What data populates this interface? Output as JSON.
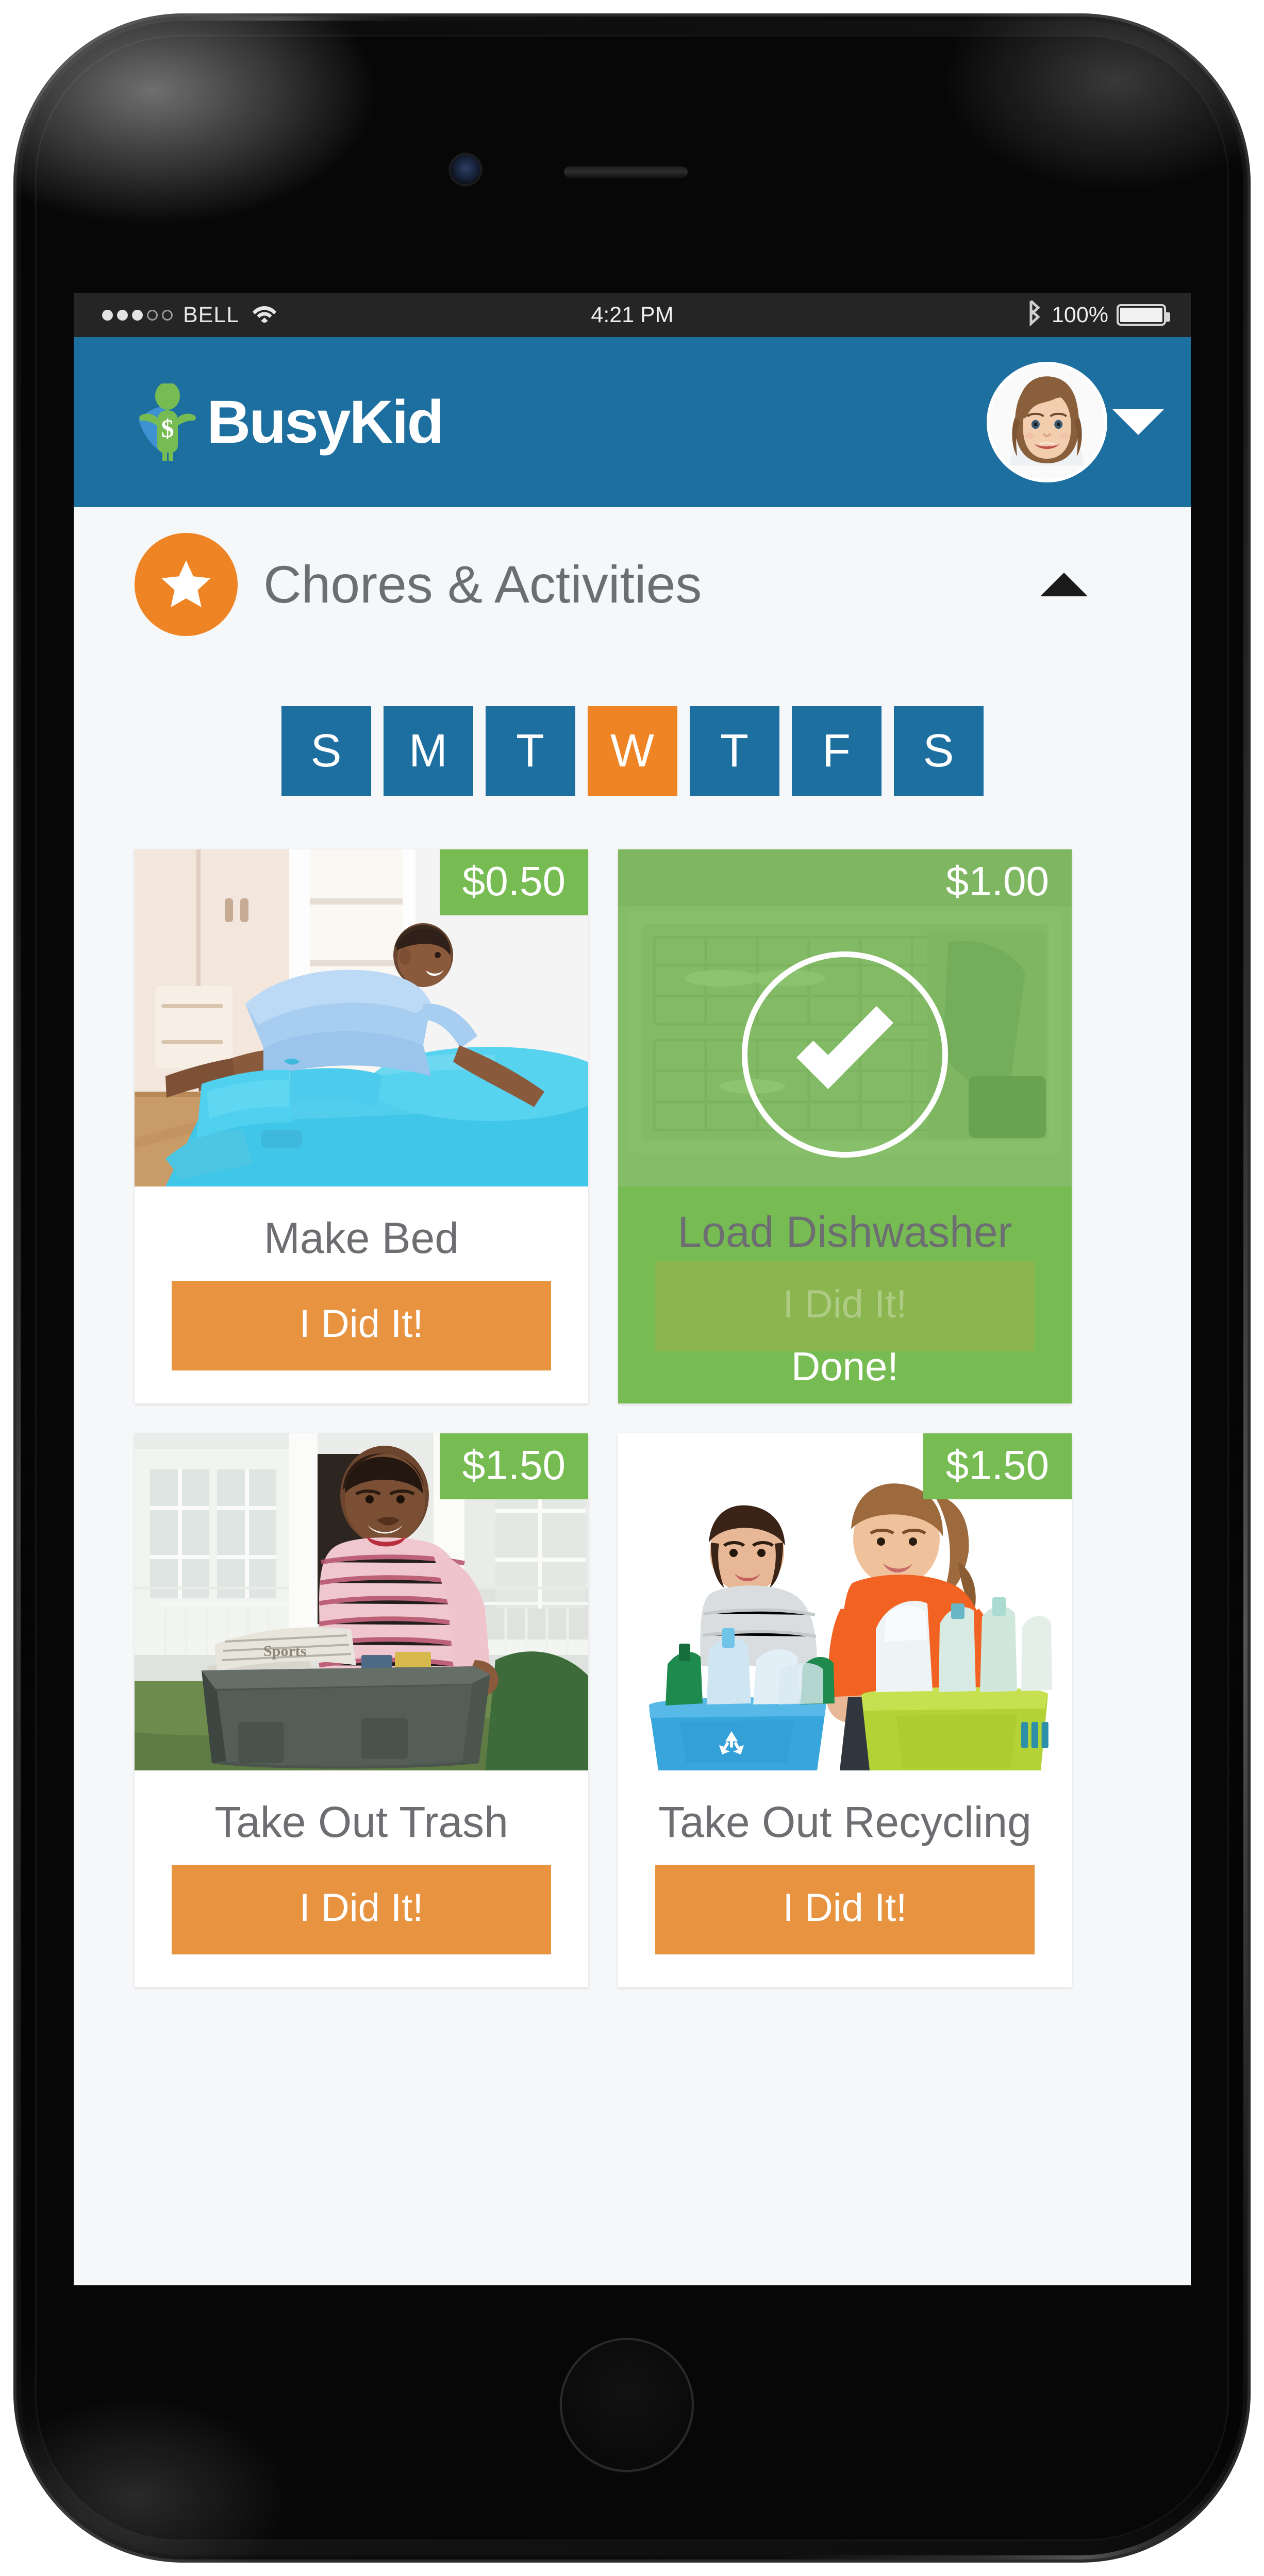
{
  "status_bar": {
    "signal_dots_filled": 3,
    "signal_dots_total": 5,
    "carrier": "BELL",
    "wifi_icon": "wifi-icon",
    "time": "4:21 PM",
    "bluetooth_icon": "bluetooth-icon",
    "battery_percent": "100%",
    "battery_level": 100
  },
  "app_header": {
    "logo_text": "BusyKid",
    "logo_mark": "busykid-superhero-icon",
    "avatar_alt": "child-profile-photo",
    "dropdown_icon": "chevron-down-icon",
    "background_color": "#1d6f9f"
  },
  "section": {
    "badge_icon": "star-icon",
    "badge_color": "#ee8423",
    "title": "Chores & Activities",
    "collapse_icon": "chevron-up-icon"
  },
  "day_selector": {
    "days": [
      {
        "label": "S",
        "active": false
      },
      {
        "label": "M",
        "active": false
      },
      {
        "label": "T",
        "active": false
      },
      {
        "label": "W",
        "active": true
      },
      {
        "label": "T",
        "active": false
      },
      {
        "label": "F",
        "active": false
      },
      {
        "label": "S",
        "active": false
      }
    ],
    "active_color": "#ee8423",
    "inactive_color": "#1d6f9f"
  },
  "chores": [
    {
      "name": "Make Bed",
      "price": "$0.50",
      "done": false,
      "action_label": "I Did It!",
      "photo": "boy-making-bed-photo"
    },
    {
      "name": "Load Dishwasher",
      "price": "$1.00",
      "done": true,
      "done_label": "Done!",
      "action_label": "I Did It!",
      "photo": "dishwasher-loading-photo"
    },
    {
      "name": "Take Out Trash",
      "price": "$1.50",
      "done": false,
      "action_label": "I Did It!",
      "photo": "boy-carrying-trash-bin-photo"
    },
    {
      "name": "Take Out Recycling",
      "price": "$1.50",
      "done": false,
      "action_label": "I Did It!",
      "photo": "kids-carrying-recycling-bins-photo"
    }
  ],
  "colors": {
    "brand_blue": "#1d6f9f",
    "brand_orange": "#ee8423",
    "button_orange": "#e8933f",
    "price_green": "#77bc53",
    "text_gray": "#6d6e71",
    "screen_bg": "#f6f7f9"
  }
}
